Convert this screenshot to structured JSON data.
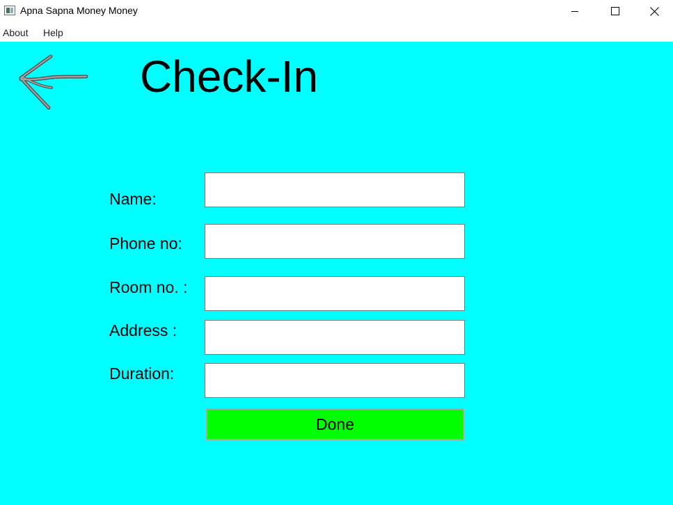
{
  "window": {
    "title": "Apna Sapna Money Money"
  },
  "menu": {
    "items": [
      {
        "label": "About"
      },
      {
        "label": "Help"
      }
    ]
  },
  "page": {
    "title": "Check-In",
    "background_color": "#00ffff",
    "back_icon": "hand-drawn-left-arrow-icon"
  },
  "form": {
    "fields": [
      {
        "label": "Name:",
        "value": ""
      },
      {
        "label": "Phone no:",
        "value": ""
      },
      {
        "label": "Room no. :",
        "value": ""
      },
      {
        "label": "Address :",
        "value": ""
      },
      {
        "label": "Duration:",
        "value": ""
      }
    ],
    "submit": {
      "label": "Done",
      "color": "#00ff00"
    }
  }
}
